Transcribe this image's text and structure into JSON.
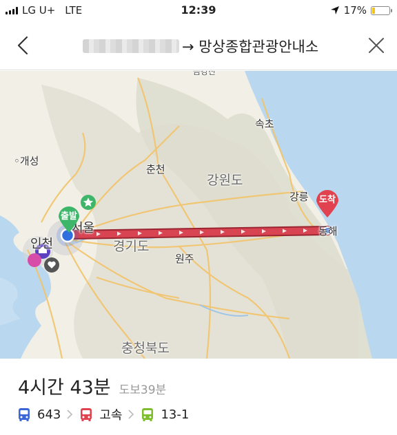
{
  "status_bar": {
    "carrier": "LG U+",
    "network": "LTE",
    "time": "12:39",
    "battery": "17%",
    "battery_level": 0.17
  },
  "header": {
    "title": "→ 망상종합관광안내소"
  },
  "map": {
    "labels": {
      "gaeseong": "개성",
      "chuncheon": "춘천",
      "gangwondo": "강원도",
      "sokcho": "속초",
      "gangneung": "강릉",
      "donghae": "동해",
      "seoul": "서울",
      "incheon": "인천",
      "gyeonggido": "경기도",
      "wonju": "원주",
      "chungcheongbukdo": "충청북도",
      "geumgangsan": "금강산"
    },
    "start_pin": "출발",
    "end_pin": "도착",
    "colors": {
      "sea": "#b9d7ef",
      "land": "#f1efe6",
      "route": "#d94452",
      "start": "#3db66a",
      "end": "#e0434f",
      "current": "#2f6fe0"
    }
  },
  "summary": {
    "duration": "4시간 43분",
    "walk": "도보39분",
    "legs": [
      {
        "icon": "bus-icon",
        "label": "643",
        "color": "#3a66d6"
      },
      {
        "icon": "bus-icon",
        "label": "고속",
        "color": "#e0434f"
      },
      {
        "icon": "bus-icon",
        "label": "13-1",
        "color": "#7cbf2a"
      }
    ]
  }
}
